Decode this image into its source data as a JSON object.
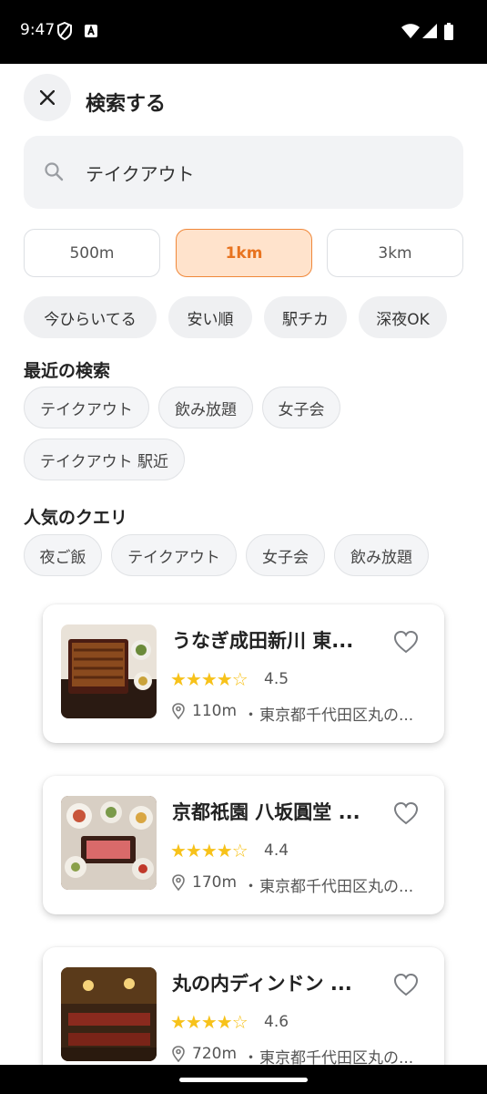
{
  "status_bar": {
    "time": "9:47"
  },
  "header": {
    "title": "検索する"
  },
  "search": {
    "value": "テイクアウト"
  },
  "distance_options": [
    "500m",
    "1km",
    "3km"
  ],
  "filters": [
    "今ひらいてる",
    "安い順",
    "駅チカ",
    "深夜OK"
  ],
  "recent": {
    "title": "最近の検索",
    "items": [
      "テイクアウト",
      "飲み放題",
      "女子会",
      "テイクアウト 駅近"
    ]
  },
  "popular": {
    "title": "人気のクエリ",
    "items": [
      "夜ご飯",
      "テイクアウト",
      "女子会",
      "飲み放題"
    ]
  },
  "results": [
    {
      "name": "うなぎ成田新川 東...",
      "stars": "★★★★☆",
      "rating": "4.5",
      "distance": "110m",
      "separator": "・",
      "address": "東京都千代田区丸の..."
    },
    {
      "name": "京都祇園 八坂圓堂 ...",
      "stars": "★★★★☆",
      "rating": "4.4",
      "distance": "170m",
      "separator": "・",
      "address": "東京都千代田区丸の..."
    },
    {
      "name": "丸の内ディンドン ...",
      "stars": "★★★★☆",
      "rating": "4.6",
      "distance": "720m",
      "separator": "・",
      "address": "東京都千代田区丸の..."
    }
  ],
  "colors": {
    "accent": "#e8731f",
    "accent_bg": "#ffe3cc",
    "star": "#f7c21a"
  }
}
